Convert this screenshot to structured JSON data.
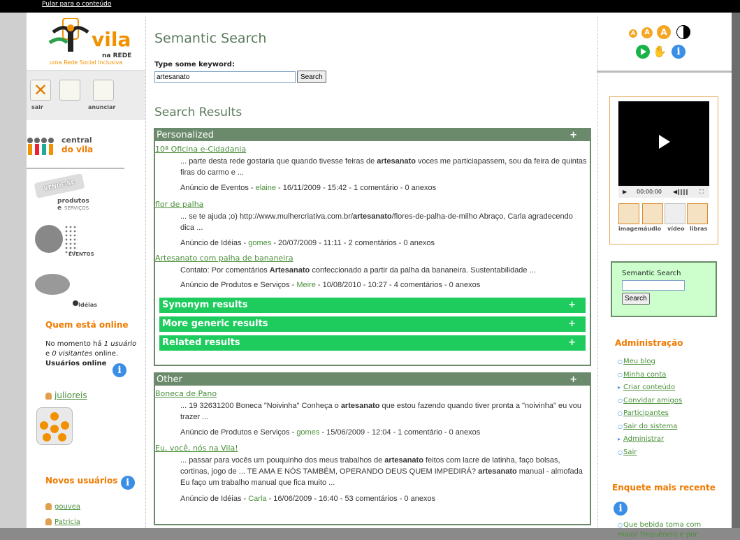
{
  "skip_link": "Pular para o conteúdo",
  "logo": {
    "vila": "vila",
    "rede": "na REDE",
    "tagline": "uma Rede Social Inclusiva"
  },
  "toolbar": {
    "sair": "sair",
    "anunciar": "anunciar"
  },
  "central": {
    "line1": "central",
    "line2": "do vila"
  },
  "nav_cards": {
    "vende_line1": "VENDE-SE",
    "vende_line2": "produtos e",
    "vende_line3": "SERVIÇOS",
    "eventos": "EVENTOS",
    "ideias": "Idéias"
  },
  "online": {
    "title": "Quem está online",
    "text_pre": "No momento há ",
    "users": "1 usuário",
    "text_mid": "e ",
    "visitors": "0 visitantes",
    "text_post": " online.",
    "users_online": "Usuários online",
    "user": "julioreis"
  },
  "new_users": {
    "title": "Novos usuários",
    "items": [
      "gouvea",
      "Patricia"
    ]
  },
  "search": {
    "title": "Semantic Search",
    "label": "Type some keyword:",
    "value": "artesanato",
    "button": "Search",
    "results_title": "Search Results"
  },
  "personalized": {
    "header": "Personalized",
    "results": [
      {
        "title": "10ª Oficina e-Cidadania",
        "snippet_a": "... parte desta rede gostaria que quando tivesse feiras de ",
        "bold": "artesanato",
        "snippet_b": " voces me particiapassem, sou da feira de quintas firas do carmo e ...",
        "meta_pre": "Anúncio de Eventos - ",
        "author": "elaine",
        "meta_post": " - 16/11/2009 - 15:42 - 1 comentário - 0 anexos"
      },
      {
        "title": "flor de palha",
        "snippet_a": "... se te ajuda ;o) http://www.mulhercriativa.com.br/",
        "bold": "artesanato",
        "snippet_b": "/flores-de-palha-de-milho Abraço, Carla agradecendo dica ...",
        "meta_pre": "Anúncio de Idéias - ",
        "author": "gomes",
        "meta_post": " - 20/07/2009 - 11:11 - 2 comentários - 0 anexos"
      },
      {
        "title": "Artesanato com palha de bananeira",
        "snippet_a": "Contato:  Por comentários ",
        "bold": "Artesanato",
        "snippet_b": " confeccionado a partir da palha da bananeira. Sustentabilidade ...",
        "meta_pre": "Anúncio de Produtos e Serviços - ",
        "author": "Meire",
        "meta_post": " - 10/08/2010 - 10:27 - 4 comentários - 0 anexos"
      }
    ],
    "bars": [
      "Synonym results",
      "More generic results",
      "Related results"
    ]
  },
  "other": {
    "header": "Other",
    "results": [
      {
        "title": "Boneca de Pano",
        "snippet_a": "... 19 32631200 Boneca \"Noivinha\" Conheça o ",
        "bold": "artesanato",
        "snippet_b": " que estou fazendo quando tiver pronta a \"noivinha\" eu vou trazer ...",
        "meta_pre": "Anúncio de Produtos e Serviços - ",
        "author": "gomes",
        "meta_post": " - 15/06/2009 - 12:04 - 1 comentário - 0 anexos"
      },
      {
        "title": "Eu, você, nós na Vila!",
        "snippet_a": "... passar para vocês um pouquinho dos meus trabalhos de ",
        "bold": "artesanato",
        "snippet_b": " feitos com lacre de latinha, faço bolsas, cortinas, jogo de ... TE AMA E NÓS TAMBÉM, OPERANDO DEUS QUEM IMPEDIRÁ? ",
        "bold2": "artesanato",
        "snippet_c": " manual - almofada Eu faço um trabalho manual que fica muito ...",
        "meta_pre": "Anúncio de Idéias - ",
        "author": "Carla",
        "meta_post": " - 16/06/2009 - 16:40 - 53 comentários - 0 anexos"
      }
    ]
  },
  "accessibility": {
    "a1": "A",
    "a2": "A",
    "a3": "A"
  },
  "video": {
    "time": "00:00:00",
    "labels": [
      "imagem",
      "áudio",
      "vídeo",
      "libras"
    ]
  },
  "side_search": {
    "label": "Semantic Search",
    "button": "Search"
  },
  "admin": {
    "title": "Administração",
    "items": [
      "Meu blog",
      "Minha conta",
      "Criar conteúdo",
      "Convidar amigos",
      "Participantes",
      "Sair do sistema",
      "Administrar",
      "Sair"
    ]
  },
  "poll": {
    "title": "Enquete mais recente",
    "question": "Que bebida toma com maior frequência e por"
  },
  "colors": {
    "accent_orange": "#f07a00",
    "link_green": "#4a8f3a",
    "bar_green": "#1ecc5e",
    "box_green": "#6b8a6b"
  }
}
